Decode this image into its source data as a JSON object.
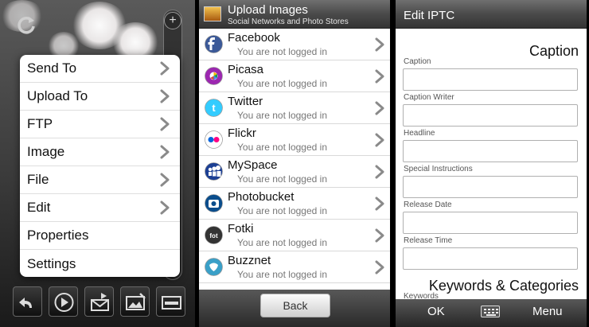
{
  "panel1": {
    "menu": [
      {
        "label": "Send To",
        "has_submenu": true
      },
      {
        "label": "Upload To",
        "has_submenu": true
      },
      {
        "label": "FTP",
        "has_submenu": true
      },
      {
        "label": "Image",
        "has_submenu": true
      },
      {
        "label": "File",
        "has_submenu": true
      },
      {
        "label": "Edit",
        "has_submenu": true
      },
      {
        "label": "Properties",
        "has_submenu": false
      },
      {
        "label": "Settings",
        "has_submenu": false
      }
    ],
    "zoom_plus": "+",
    "toolbar_icons": [
      "back-arrow-icon",
      "play-icon",
      "send-mail-icon",
      "edit-image-icon",
      "keyboard-icon"
    ]
  },
  "panel2": {
    "title": "Upload Images",
    "subtitle": "Social Networks and Photo Stores",
    "services": [
      {
        "name": "Facebook",
        "status": "You are not logged in",
        "icon": "facebook-icon",
        "color": "#3b5998"
      },
      {
        "name": "Picasa",
        "status": "You are not logged in",
        "icon": "picasa-icon",
        "color": "#9c27b0"
      },
      {
        "name": "Twitter",
        "status": "You are not logged in",
        "icon": "twitter-icon",
        "color": "#33ccff"
      },
      {
        "name": "Flickr",
        "status": "You are not logged in",
        "icon": "flickr-icon",
        "color": "#ff0084"
      },
      {
        "name": "MySpace",
        "status": "You are not logged in",
        "icon": "myspace-icon",
        "color": "#1c3f94"
      },
      {
        "name": "Photobucket",
        "status": "You are not logged in",
        "icon": "photobucket-icon",
        "color": "#0a4d8c"
      },
      {
        "name": "Fotki",
        "status": "You are not logged in",
        "icon": "fotki-icon",
        "color": "#333333"
      },
      {
        "name": "Buzznet",
        "status": "You are not logged in",
        "icon": "buzznet-icon",
        "color": "#3aa0c8"
      }
    ],
    "back_label": "Back"
  },
  "panel3": {
    "title": "Edit IPTC",
    "caption_section": "Caption",
    "fields": [
      {
        "label": "Caption",
        "value": ""
      },
      {
        "label": "Caption Writer",
        "value": ""
      },
      {
        "label": "Headline",
        "value": ""
      },
      {
        "label": "Special Instructions",
        "value": ""
      },
      {
        "label": "Release Date",
        "value": ""
      },
      {
        "label": "Release Time",
        "value": ""
      }
    ],
    "keywords_section": "Keywords & Categories",
    "keywords_label": "Keywords",
    "softkey_left": "OK",
    "softkey_right": "Menu"
  }
}
